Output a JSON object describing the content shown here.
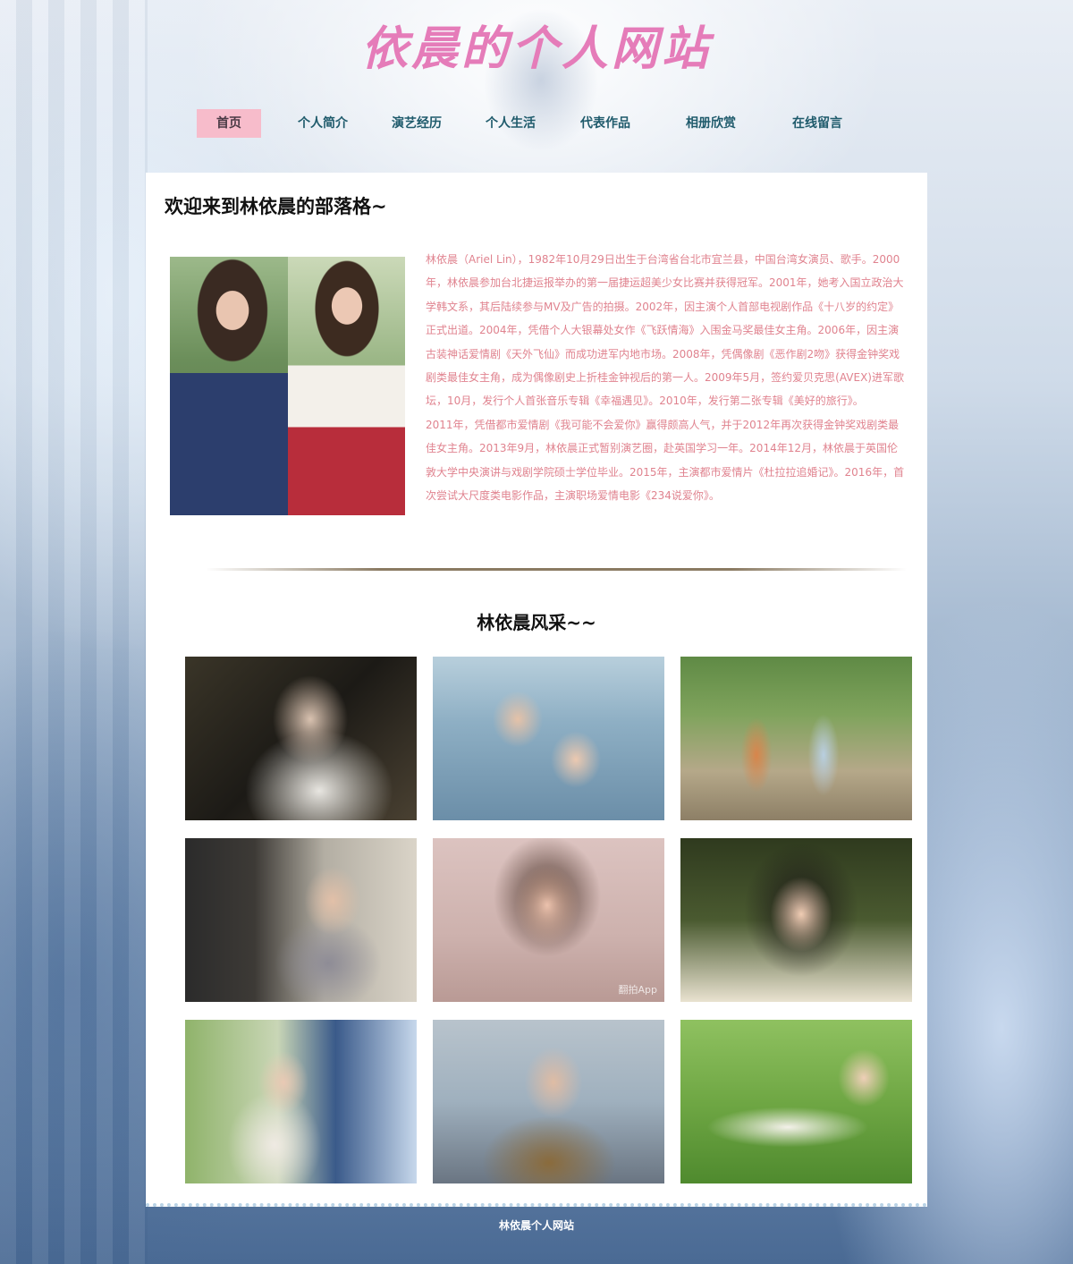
{
  "header": {
    "site_title": "依晨的个人网站"
  },
  "nav": {
    "items": [
      {
        "label": "首页",
        "active": true
      },
      {
        "label": "个人简介",
        "active": false
      },
      {
        "label": "演艺经历",
        "active": false
      },
      {
        "label": "个人生活",
        "active": false
      },
      {
        "label": "代表作品",
        "active": false
      },
      {
        "label": "相册欣赏",
        "active": false
      },
      {
        "label": "在线留言",
        "active": false
      }
    ]
  },
  "main": {
    "welcome_title": "欢迎来到林依晨的部落格~",
    "intro_paragraphs": [
      "林依晨（Ariel Lin），1982年10月29日出生于台湾省台北市宜兰县，中国台湾女演员、歌手。2000年，林依晨参加台北捷运报举办的第一届捷运超美少女比赛并获得冠军。2001年，她考入国立政治大学韩文系，其后陆续参与MV及广告的拍摄。2002年，因主演个人首部电视剧作品《十八岁的约定》正式出道。2004年，凭借个人大银幕处女作《飞跃情海》入围金马奖最佳女主角。2006年，因主演古装神话爱情剧《天外飞仙》而成功进军内地市场。2008年，凭偶像剧《恶作剧2吻》获得金钟奖戏剧类最佳女主角，成为偶像剧史上折桂金钟视后的第一人。2009年5月，签约爱贝克思(AVEX)进军歌坛，10月，发行个人首张音乐专辑《幸福遇见》。2010年，发行第二张专辑《美好的旅行》。",
      "2011年，凭借都市爱情剧《我可能不会爱你》赢得颇高人气，并于2012年再次获得金钟奖戏剧类最佳女主角。2013年9月，林依晨正式暂别演艺圈，赴英国学习一年。2014年12月，林依晨于英国伦敦大学中央演讲与戏剧学院硕士学位毕业。2015年，主演都市爱情片《杜拉拉追婚记》。2016年，首次尝试大尺度类电影作品，主演职场爱情电影《234说爱你》。"
    ],
    "gallery_title": "林依晨风采~~",
    "photo_watermark": "翻拍App"
  },
  "footer": {
    "text": "林依晨个人网站"
  },
  "colors": {
    "title_pink": "#e57cb9",
    "nav_text": "#1e5a6b",
    "nav_active_bg": "#f7bccb",
    "intro_text": "#e0838f"
  }
}
